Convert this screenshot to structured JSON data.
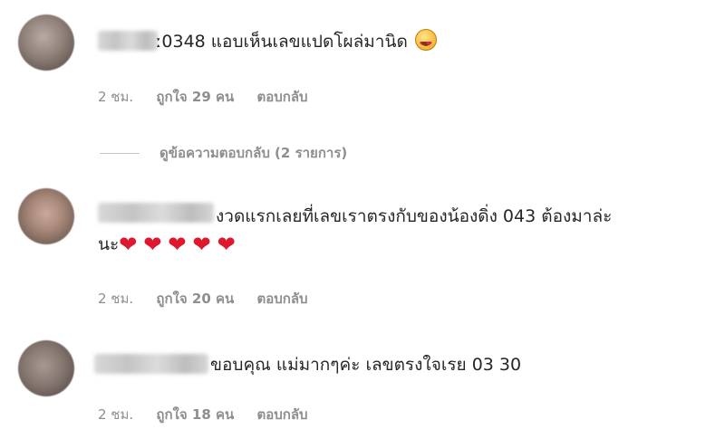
{
  "comments": [
    {
      "text": "ː0348 แอบเห็นเลขแปดโผล่มานิด",
      "emoji": "heart-eyes-emoji",
      "time": "2 ชม.",
      "likes": "ถูกใจ 29 คน",
      "reply": "ตอบกลับ"
    },
    {
      "text_line1": "งวดแรกเลยที่เลขเราตรงกับของน้องดิ่ง 043 ต้องมาล่ะ",
      "text_line2": "นะ",
      "hearts": 5,
      "time": "2 ชม.",
      "likes": "ถูกใจ 20 คน",
      "reply": "ตอบกลับ"
    },
    {
      "text": "ขอบคุณ แม่มากๆค่ะ เลขตรงใจเรย 03 30",
      "time": "2 ชม.",
      "likes": "ถูกใจ 18 คน",
      "reply": "ตอบกลับ"
    }
  ],
  "view_replies": "ดูข้อความตอบกลับ (2 รายการ)",
  "colors": {
    "text": "#262626",
    "meta": "#8e8e8e",
    "heart": "#e0182e"
  }
}
